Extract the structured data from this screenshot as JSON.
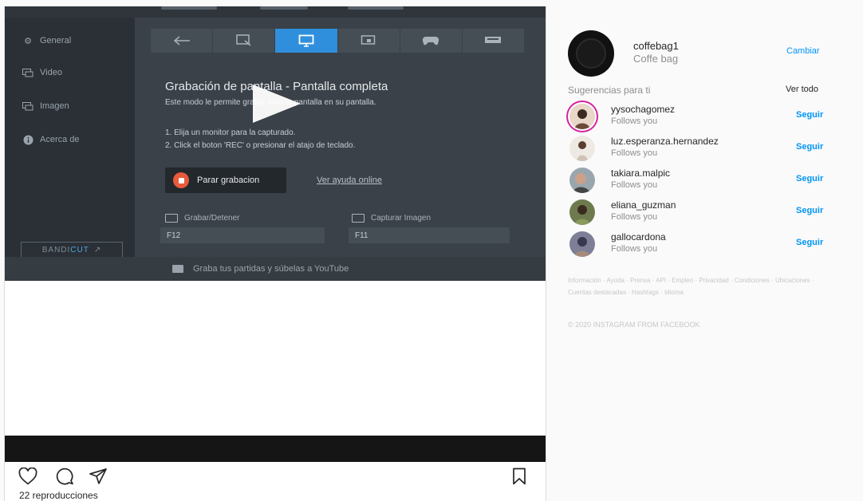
{
  "bandicam": {
    "sidebar": [
      {
        "label": "General",
        "icon": "gear-icon"
      },
      {
        "label": "Video",
        "icon": "video-icon"
      },
      {
        "label": "Imagen",
        "icon": "image-icon"
      },
      {
        "label": "Acerca de",
        "icon": "info-icon"
      }
    ],
    "brand": {
      "main": "BANDI",
      "accent": "CUT"
    },
    "title": "Grabación de pantalla - Pantalla completa",
    "desc": "Este modo le permite grabar toda la pantalla en su pantalla.",
    "step1": "1. Elija un monitor para la capturado.",
    "step2": "2. Click el boton 'REC' o presionar el atajo de teclado.",
    "stop_button": "Parar grabacion",
    "help_link": "Ver ayuda online",
    "hotkey_record_label": "Grabar/Detener",
    "hotkey_record_value": "F12",
    "hotkey_capture_label": "Capturar Imagen",
    "hotkey_capture_value": "F11",
    "youtube_tip": "Graba tus partidas y súbelas a YouTube"
  },
  "post": {
    "views": "22 reproducciones"
  },
  "sidebar": {
    "username": "coffebag1",
    "fullname": "Coffe bag",
    "switch": "Cambiar",
    "suggestions_title": "Sugerencias para ti",
    "see_all": "Ver todo",
    "suggestions": [
      {
        "username": "yysochagomez",
        "sub": "Follows you",
        "action": "Seguir"
      },
      {
        "username": "luz.esperanza.hernandez",
        "sub": "Follows you",
        "action": "Seguir"
      },
      {
        "username": "takiara.malpic",
        "sub": "Follows you",
        "action": "Seguir"
      },
      {
        "username": "eliana_guzman",
        "sub": "Follows you",
        "action": "Seguir"
      },
      {
        "username": "gallocardona",
        "sub": "Follows you",
        "action": "Seguir"
      }
    ],
    "footer": "Información · Ayuda · Prensa · API · Empleo · Privacidad · Condiciones · Ubicaciones · Cuentas destacadas · Hashtags · Idioma",
    "copyright": "© 2020 INSTAGRAM FROM FACEBOOK"
  },
  "colors": {
    "link": "#0095f6",
    "accent": "#2f8fdc",
    "rec": "#e85a3c"
  }
}
